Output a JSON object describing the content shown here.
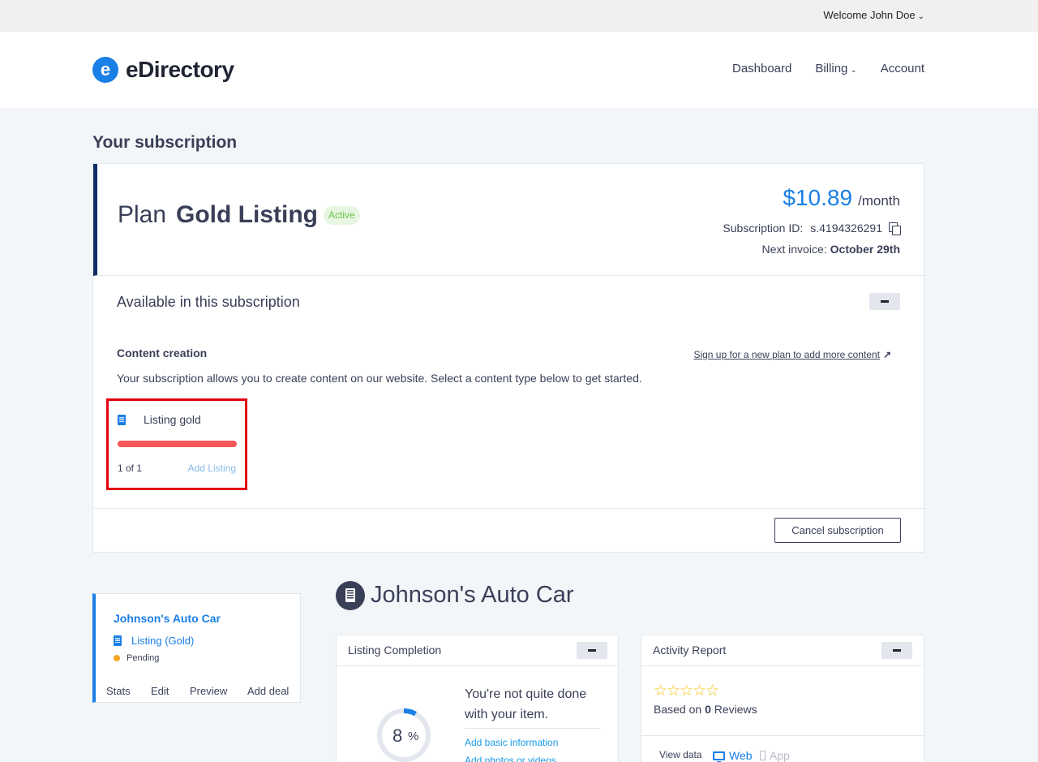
{
  "topbar": {
    "welcome": "Welcome John Doe"
  },
  "header": {
    "logo_mark": "e",
    "logo_text": "eDirectory",
    "nav": {
      "dashboard": "Dashboard",
      "billing": "Billing",
      "account": "Account"
    }
  },
  "page": {
    "section_title": "Your subscription"
  },
  "subscription": {
    "plan_label": "Plan",
    "plan_name": "Gold Listing",
    "status": "Active",
    "price": "$10.89",
    "period": "/month",
    "subscription_id_label": "Subscription ID:",
    "subscription_id": "s.4194326291",
    "next_invoice_label": "Next invoice:",
    "next_invoice": "October 29th",
    "available_title": "Available in this subscription",
    "content_creation_title": "Content creation",
    "signup_link": "Sign up for a new plan to add more content",
    "description": "Your subscription allows you to create content on our website. Select a content type below to get started.",
    "listing": {
      "label": "Listing gold",
      "count": "1 of 1",
      "used_fraction": 1.0,
      "add_label": "Add Listing"
    },
    "cancel_label": "Cancel subscription"
  },
  "listing_card": {
    "name": "Johnson's Auto Car",
    "type": "Listing (Gold)",
    "status": "Pending",
    "actions": {
      "stats": "Stats",
      "edit": "Edit",
      "preview": "Preview",
      "add_deal": "Add deal"
    }
  },
  "listing_detail": {
    "title": "Johnson's Auto Car",
    "completion": {
      "title": "Listing Completion",
      "percent": "8",
      "percent_sign": "%",
      "message": "You're not quite done with your item.",
      "steps": [
        "Add basic information",
        "Add photos or videos"
      ]
    },
    "activity": {
      "title": "Activity Report",
      "stars": "☆☆☆☆☆",
      "rating": 0,
      "based_on": "Based on",
      "reviews_count": "0",
      "reviews_word": "Reviews",
      "view_data": "View data",
      "web": "Web",
      "app": "App"
    }
  },
  "colors": {
    "accent": "#1a7fe6",
    "dark": "#3a3f58",
    "navy": "#0f2e66",
    "danger": "#f55656",
    "active": "#6cc24a"
  }
}
